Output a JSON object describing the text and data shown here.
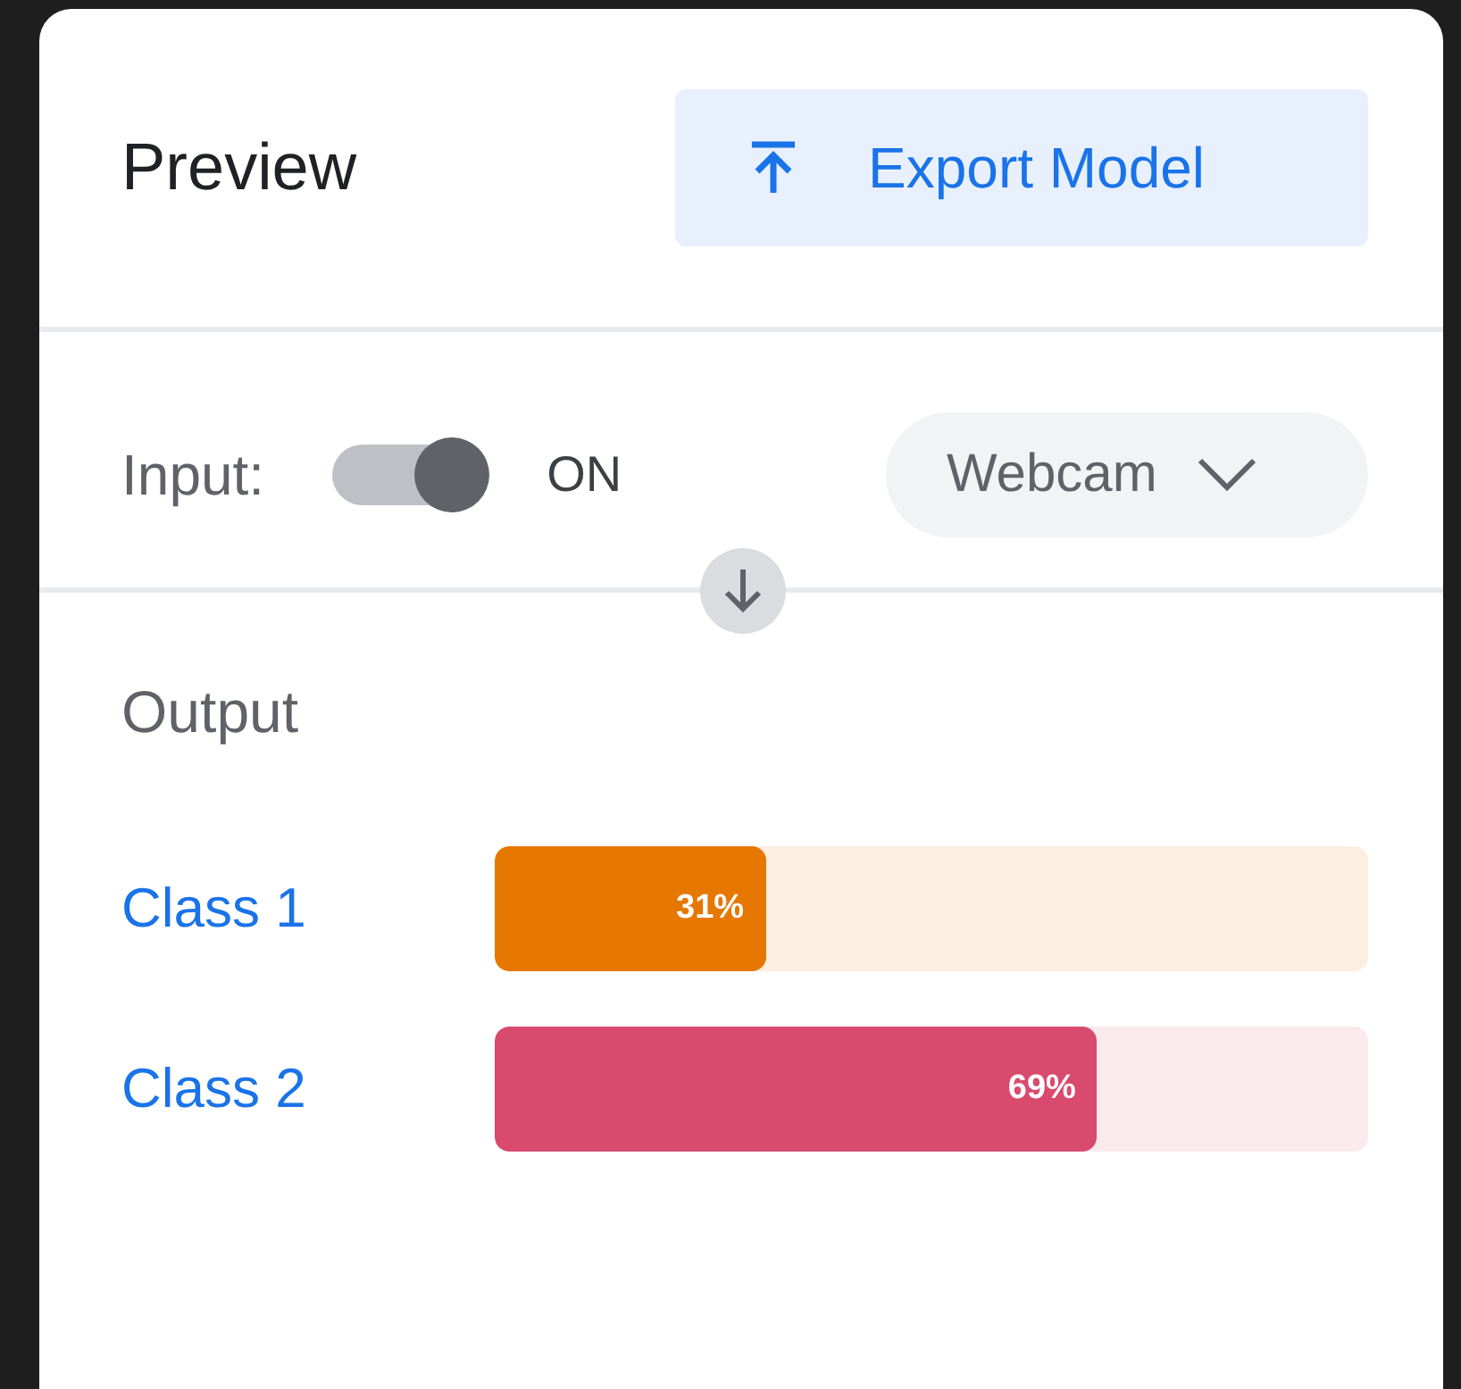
{
  "header": {
    "title": "Preview",
    "export_button": "Export Model"
  },
  "input": {
    "label": "Input:",
    "toggle": {
      "on": true,
      "label": "ON"
    },
    "source": "Webcam"
  },
  "output": {
    "title": "Output",
    "classes": [
      {
        "name": "Class 1",
        "level": 0.31,
        "reading": "31%",
        "color": "#e67700"
      },
      {
        "name": "Class 2",
        "level": 0.69,
        "reading": "69%",
        "color": "#d84a6e"
      }
    ]
  }
}
